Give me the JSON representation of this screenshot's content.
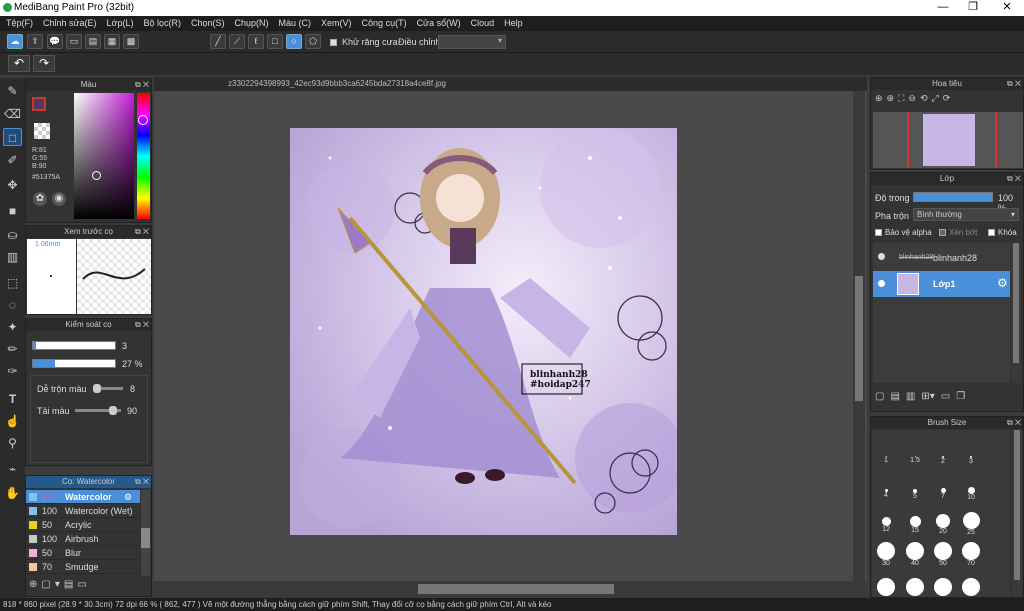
{
  "window": {
    "title": "MediBang Paint Pro (32bit)"
  },
  "menu": [
    "Tệp(F)",
    "Chỉnh sửa(E)",
    "Lớp(L)",
    "Bộ lọc(R)",
    "Chọn(S)",
    "Chụp(N)",
    "Màu (C)",
    "Xem(V)",
    "Công cụ(T)",
    "Cửa sổ(W)",
    "Cloud",
    "Help"
  ],
  "toolbar": {
    "antialias_label": "Khử răng cưa",
    "adjust_label": "Điều chỉnh"
  },
  "panels": {
    "color": {
      "title": "Màu",
      "r": "R:81",
      "g": "G:55",
      "b": "B:90",
      "hex": "#51375A"
    },
    "brush_preview": {
      "title": "Xem trước cọ",
      "size": "1.06mm"
    },
    "brush_control": {
      "title": "Kiểm soát cọ",
      "size_value": "3",
      "opacity_value": "27 %",
      "mix_label": "Dễ trộn màu",
      "mix_value": "8",
      "load_label": "Tải màu",
      "load_value": "90"
    },
    "brush_list": {
      "title": "Cọ: Watercolor",
      "items": [
        {
          "size": "3.0",
          "name": "Watercolor",
          "color": "#7fc4f0",
          "selected": true
        },
        {
          "size": "100",
          "name": "Watercolor (Wet)",
          "color": "#7fc4f0"
        },
        {
          "size": "50",
          "name": "Acrylic",
          "color": "#e8d020"
        },
        {
          "size": "100",
          "name": "Airbrush",
          "color": "#c8c8c8"
        },
        {
          "size": "50",
          "name": "Blur",
          "color": "#f0b0e0"
        },
        {
          "size": "70",
          "name": "Smudge",
          "color": "#f0c8a0"
        }
      ]
    },
    "navigator": {
      "title": "Hoa tiêu"
    },
    "layer": {
      "title": "Lớp",
      "opacity_label": "Độ trong",
      "opacity_value": "100 %",
      "blend_label": "Pha trộn",
      "blend_value": "Bình thường",
      "protect_alpha": "Bảo vệ alpha",
      "clipping": "Xén bớt",
      "lock": "Khóa",
      "layers": [
        {
          "name": "blinhanh28",
          "thumb_text": "blinhanh28",
          "selected": false
        },
        {
          "name": "Lớp1",
          "selected": true
        }
      ]
    },
    "brush_size": {
      "title": "Brush Size",
      "sizes": [
        "1",
        "1.5",
        "2",
        "3",
        "4",
        "5",
        "7",
        "10",
        "12",
        "15",
        "20",
        "25",
        "30",
        "40",
        "50",
        "70"
      ]
    }
  },
  "document": {
    "tab": "z3302294398993_42ec93d9bbb3ca6245bda27318a4ce8f.jpg",
    "watermark_line1": "blinhanh28",
    "watermark_line2": "#hoidap247"
  },
  "status": {
    "text": "818 * 860 pixel   (28.9 * 30.3cm)  72 dpi  66 %  ( 862, 477 )  Vẽ một đường thẳng bằng cách giữ phím Shift, Thay đổi cỡ cọ bằng cách giữ phím Ctrl, Alt và kéo"
  }
}
